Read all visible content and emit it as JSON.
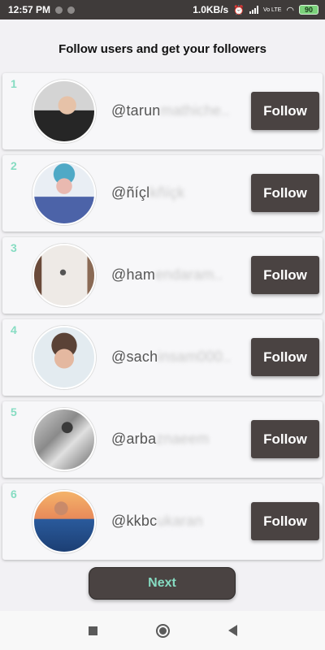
{
  "status_bar": {
    "time": "12:57 PM",
    "speed": "1.0KB/s",
    "network": "Vo LTE",
    "battery": "90"
  },
  "header": {
    "title": "Follow users and get your followers"
  },
  "users": [
    {
      "rank": "1",
      "handle_visible": "@tarun",
      "handle_blurred": "mathiche..",
      "follow_label": "Follow",
      "avatar_colors": [
        "#c9c9c9",
        "#2c2c2c"
      ]
    },
    {
      "rank": "2",
      "handle_visible": "@ñíçl",
      "handle_blurred": "kñíçk",
      "follow_label": "Follow",
      "avatar_colors": [
        "#cfe0ee",
        "#3a4e8c"
      ]
    },
    {
      "rank": "3",
      "handle_visible": "@ham",
      "handle_blurred": "endaram..",
      "follow_label": "Follow",
      "avatar_colors": [
        "#e8e4e0",
        "#7a5a4a"
      ]
    },
    {
      "rank": "4",
      "handle_visible": "@sach",
      "handle_blurred": "insam000..",
      "follow_label": "Follow",
      "avatar_colors": [
        "#dfe6ea",
        "#5a4a40"
      ]
    },
    {
      "rank": "5",
      "handle_visible": "@arba",
      "handle_blurred": "znaeem",
      "follow_label": "Follow",
      "avatar_colors": [
        "#b9b9b9",
        "#3a3a3a"
      ]
    },
    {
      "rank": "6",
      "handle_visible": "@kkbc",
      "handle_blurred": "ukaran",
      "follow_label": "Follow",
      "avatar_colors": [
        "#f1a55a",
        "#1e4c8c"
      ]
    }
  ],
  "footer": {
    "next_label": "Next"
  },
  "colors": {
    "accent": "#86dcc2",
    "button": "#4a4342",
    "status_bar": "#3f3b3a"
  }
}
